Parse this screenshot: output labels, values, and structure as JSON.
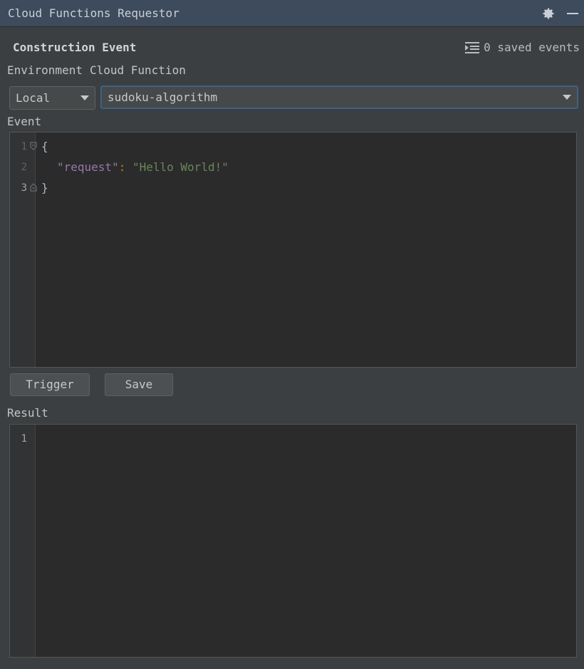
{
  "window": {
    "title": "Cloud Functions Requestor"
  },
  "header": {
    "section_title": "Construction Event",
    "saved_events": "0 saved events"
  },
  "labels": {
    "environment": "Environment",
    "cloud_function": "Cloud Function",
    "event": "Event",
    "result": "Result"
  },
  "environment_select": {
    "value": "Local"
  },
  "function_select": {
    "value": "sudoku-algorithm"
  },
  "event_editor": {
    "line_numbers": [
      "1",
      "2",
      "3"
    ],
    "lines": {
      "open_brace": "{",
      "key": "\"request\"",
      "colon": ":",
      "value": "\"Hello World!\"",
      "close_brace": "}"
    }
  },
  "buttons": {
    "trigger": "Trigger",
    "save": "Save"
  },
  "result_editor": {
    "line_numbers": [
      "1"
    ]
  },
  "icons": {
    "settings": "gear-icon",
    "minimize": "minimize-icon",
    "saved_list": "list-icon",
    "dropdown": "chevron-down-icon"
  },
  "colors": {
    "title_bar": "#3d4b5c",
    "panel_bg": "#3c3f41",
    "editor_bg": "#2b2b2b",
    "focus_border": "#3d6185",
    "json_key": "#9876aa",
    "json_string": "#6a8759"
  }
}
